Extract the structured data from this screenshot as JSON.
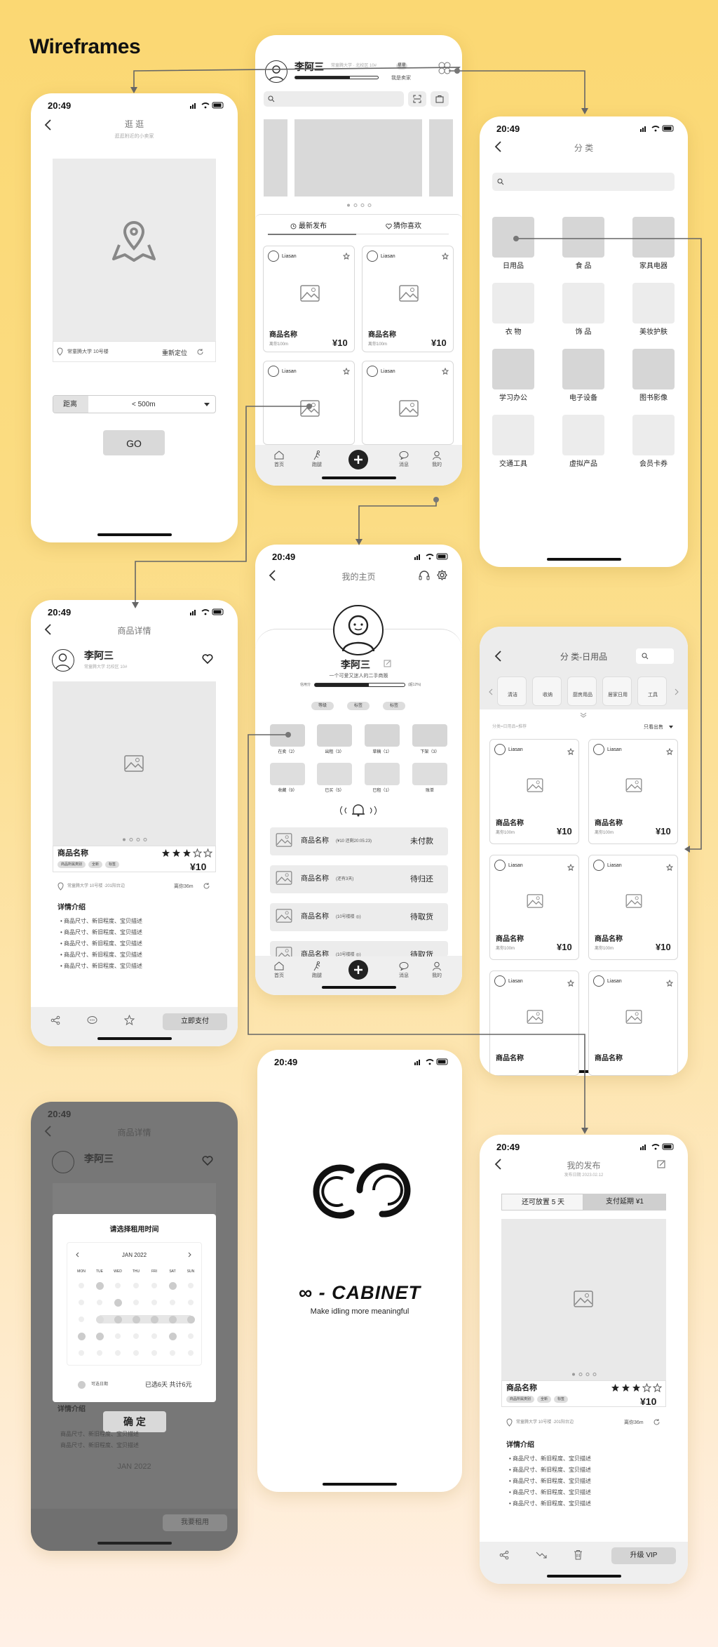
{
  "page": {
    "title": "Wireframes"
  },
  "status_time": "20:49",
  "home": {
    "user_name": "李阿三",
    "user_sub": "常童腾大学 · 北校区 10#",
    "badge": "星星",
    "role_label": "我是卖家",
    "tabs": [
      "最新发布",
      "猜你喜欢"
    ],
    "products": [
      {
        "user": "Liasan",
        "name": "商品名称",
        "distance": "离你100m",
        "price": "¥10"
      },
      {
        "user": "Liasan",
        "name": "商品名称",
        "distance": "离你100m",
        "price": "¥10"
      },
      {
        "user": "Liasan"
      },
      {
        "user": "Liasan"
      }
    ],
    "nav": [
      "首页",
      "跑腿",
      "消息",
      "我的"
    ]
  },
  "explore": {
    "title": "逛 逛",
    "subtitle": "逛逛附近的小卖家",
    "location": "常童腾大学 10号楼",
    "relocate": "重新定位",
    "distance_label": "距离",
    "distance_value": "< 500m",
    "go": "GO"
  },
  "category": {
    "title": "分 类",
    "items": [
      "日用品",
      "食 品",
      "家具电器",
      "衣 物",
      "饰 品",
      "美妆护肤",
      "学习办公",
      "电子设备",
      "图书影像",
      "交通工具",
      "虚拟产品",
      "会员卡券"
    ]
  },
  "detail": {
    "title": "商品详情",
    "user_name": "李阿三",
    "user_sub": "常童腾大学 北校区 10#",
    "product_name": "商品名称",
    "tags": [
      "商品所属类别",
      "全新",
      "标签"
    ],
    "price": "¥10",
    "location": "常童腾大学 10号楼 ·201阳台边",
    "distance": "离你36m",
    "desc_title": "详情介绍",
    "desc_items": [
      "商品尺寸、新旧程度、宝贝描述",
      "商品尺寸、新旧程度、宝贝描述",
      "商品尺寸、新旧程度、宝贝描述",
      "商品尺寸、新旧程度、宝贝描述",
      "商品尺寸、新旧程度、宝贝描述"
    ],
    "pay_button": "立即支付"
  },
  "profile": {
    "title": "我的主页",
    "name": "李阿三",
    "bio": "一个可爱又迷人的二手商贩",
    "credit_label": "信用分",
    "credit_value": "(超12%)",
    "credit_fraction": 0.6,
    "buttons": [
      "等级",
      "标签",
      "标签"
    ],
    "stats_row1": [
      "在卖（2）",
      "出租（3）",
      "草稿（1）",
      "下架（3）"
    ],
    "stats_row2": [
      "收藏（9）",
      "已买（5）",
      "已租（1）",
      "账单"
    ],
    "orders": [
      {
        "name": "商品名称",
        "note": "(¥10 还剩20:05:23)",
        "status": "未付款"
      },
      {
        "name": "商品名称",
        "note": "(还有3天)",
        "status": "待归还"
      },
      {
        "name": "商品名称",
        "note": "(10号楼楼 ◎)",
        "status": "待取货"
      },
      {
        "name": "商品名称",
        "note": "(10号楼楼 ◎)",
        "status": "待取货"
      }
    ],
    "nav": [
      "首页",
      "跑腿",
      "消息",
      "我的"
    ]
  },
  "category_list": {
    "title": "分 类-日用品",
    "subcats": [
      "清洁",
      "收纳",
      "厨房用品",
      "居家日用",
      "工具"
    ],
    "hint": "分类=日用品=推荐",
    "filter": "只看出售",
    "products": [
      {
        "user": "Liasan",
        "name": "商品名称",
        "distance": "离你100m",
        "price": "¥10"
      },
      {
        "user": "Liasan",
        "name": "商品名称",
        "distance": "离你100m",
        "price": "¥10"
      },
      {
        "user": "Liasan",
        "name": "商品名称",
        "distance": "离你100m",
        "price": "¥10"
      },
      {
        "user": "Liasan",
        "name": "商品名称",
        "distance": "离你100m",
        "price": "¥10"
      },
      {
        "user": "Liasan",
        "name": "商品名称"
      },
      {
        "user": "Liasan",
        "name": "商品名称"
      }
    ]
  },
  "rental": {
    "bg_title": "商品详情",
    "bg_name": "李阿三",
    "modal_title": "请选择租用时间",
    "month": "JAN 2022",
    "weekdays": [
      "MON",
      "TUE",
      "WED",
      "THU",
      "FRI",
      "SAT",
      "SUN"
    ],
    "legend": "可选日期",
    "summary": "已选6天 共计6元",
    "confirm": "确 定",
    "bg_desc_title": "详情介绍",
    "bg_desc_items": [
      "商品尺寸、新旧程度、宝贝描述",
      "商品尺寸、新旧程度、宝贝描述"
    ],
    "bg_button": "我要租用"
  },
  "splash": {
    "brand": "∞ - CABINET",
    "slogan": "Make idling more meaningful"
  },
  "my_post": {
    "title": "我的发布",
    "date": "发布日期 2023.02.12",
    "tabs": [
      "还可放置 5 天",
      "支付延期 ¥1"
    ],
    "product_name": "商品名称",
    "tags": [
      "商品所属类别",
      "全新",
      "标签"
    ],
    "price": "¥10",
    "location": "常童腾大学 10号楼 ·201阳台边",
    "distance": "离你36m",
    "desc_title": "详情介绍",
    "desc_items": [
      "商品尺寸、新旧程度、宝贝描述",
      "商品尺寸、新旧程度、宝贝描述",
      "商品尺寸、新旧程度、宝贝描述",
      "商品尺寸、新旧程度、宝贝描述",
      "商品尺寸、新旧程度、宝贝描述"
    ],
    "vip_button": "升级 VIP"
  }
}
